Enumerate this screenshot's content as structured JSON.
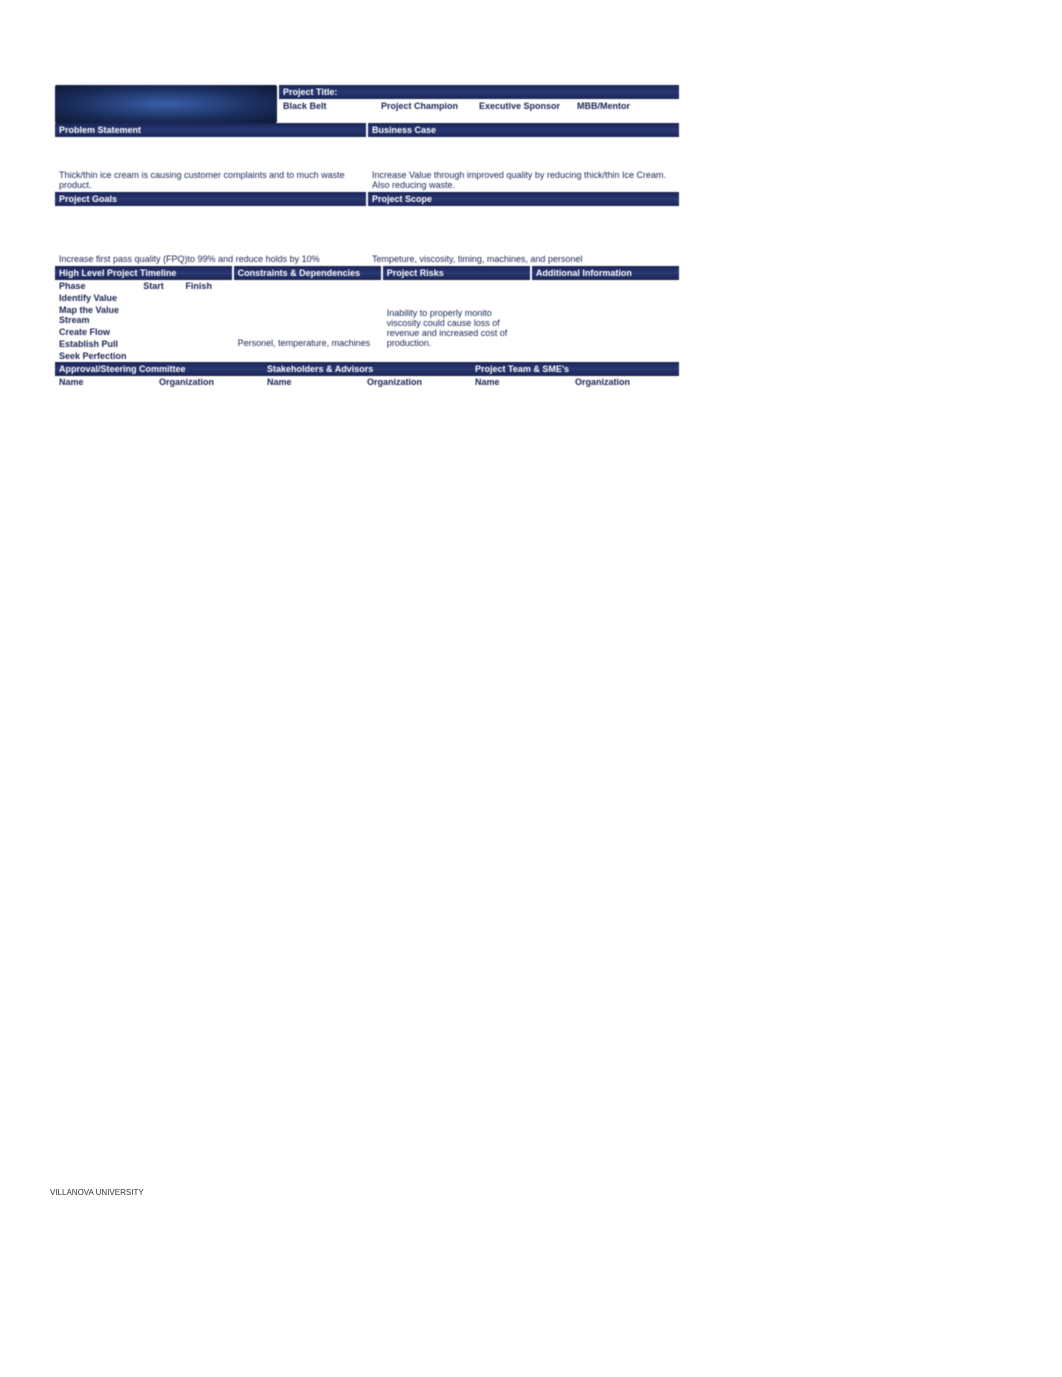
{
  "header": {
    "project_title_label": "Project Title:",
    "roles": {
      "black_belt": "Black Belt",
      "project_champion": "Project Champion",
      "executive_sponsor": "Executive Sponsor",
      "mbb_mentor": "MBB/Mentor"
    }
  },
  "problem_statement": {
    "label": "Problem Statement",
    "text": "Thick/thin ice cream is causing customer complaints and to much waste product."
  },
  "business_case": {
    "label": "Business Case",
    "text": "Increase Value through improved quality by reducing thick/thin Ice Cream. Also reducing waste."
  },
  "project_goals": {
    "label": "Project Goals",
    "text": "Increase first pass quality (FPQ)to 99% and reduce holds by 10%"
  },
  "project_scope": {
    "label": "Project Scope",
    "text": "Tempeture, viscosity, timing, machines, and personel"
  },
  "timeline": {
    "label": "High Level Project Timeline",
    "phase_label": "Phase",
    "start_label": "Start",
    "finish_label": "Finish",
    "phases": [
      "Identify Value",
      "Map the Value Stream",
      "Create Flow",
      "Establish Pull",
      "Seek Perfection"
    ]
  },
  "constraints": {
    "label": "Constraints & Dependencies",
    "text": "Personel, temperature, machines"
  },
  "risks": {
    "label": "Project Risks",
    "text": "Inability to properly monito viscosity could cause loss of revenue and increased cost of production."
  },
  "additional": {
    "label": "Additional Information"
  },
  "approval": {
    "label": "Approval/Steering Committee",
    "name_label": "Name",
    "org_label": "Organization"
  },
  "stakeholders": {
    "label": "Stakeholders & Advisors",
    "name_label": "Name",
    "org_label": "Organization"
  },
  "team": {
    "label": "Project Team & SME's",
    "name_label": "Name",
    "org_label": "Organization"
  },
  "footer": "VILLANOVA UNIVERSITY"
}
